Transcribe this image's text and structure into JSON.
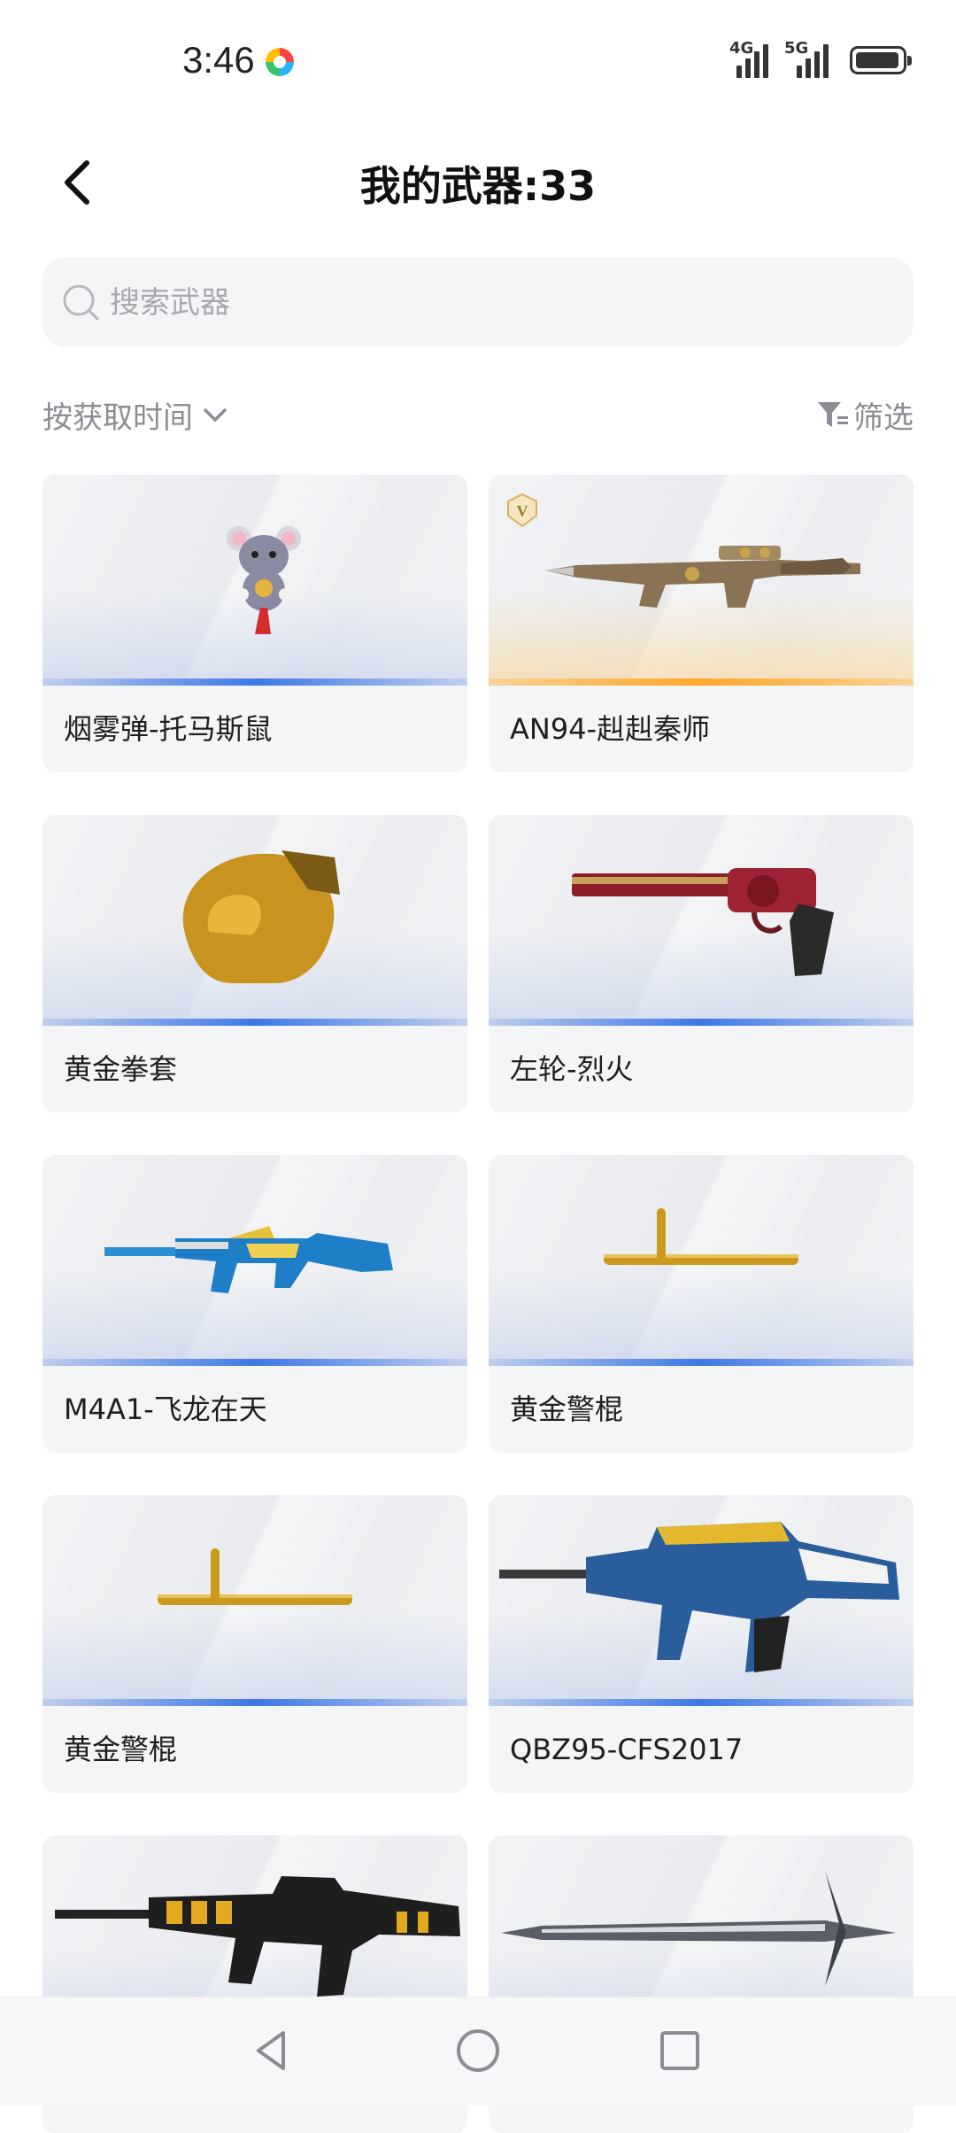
{
  "status_bar": {
    "time": "3:46",
    "network_1": "4G",
    "network_2": "5G"
  },
  "header": {
    "title": "我的武器:33"
  },
  "search": {
    "placeholder": "搜索武器",
    "value": ""
  },
  "toolbar": {
    "sort_label": "按获取时间",
    "filter_label": "筛选"
  },
  "weapons": [
    {
      "name": "烟雾弹-托马斯鼠",
      "rarity": "blue",
      "icon": "mouse-grenade-icon"
    },
    {
      "name": "AN94-赳赳秦师",
      "rarity": "gold",
      "icon": "an94-rifle-icon",
      "badge": "V"
    },
    {
      "name": "黄金拳套",
      "rarity": "blue",
      "icon": "boxing-glove-icon"
    },
    {
      "name": "左轮-烈火",
      "rarity": "blue",
      "icon": "revolver-icon"
    },
    {
      "name": "M4A1-飞龙在天",
      "rarity": "blue",
      "icon": "m4a1-rifle-icon"
    },
    {
      "name": "黄金警棍",
      "rarity": "blue",
      "icon": "baton-icon"
    },
    {
      "name": "黄金警棍",
      "rarity": "blue",
      "icon": "baton-icon"
    },
    {
      "name": "QBZ95-CFS2017",
      "rarity": "blue",
      "icon": "qbz95-rifle-icon"
    },
    {
      "name": "",
      "rarity": "blue",
      "icon": "gold-m4-rifle-icon"
    },
    {
      "name": "",
      "rarity": "blue",
      "icon": "silver-blade-icon"
    }
  ],
  "colors": {
    "accent_blue": "#3c78e6",
    "accent_gold": "#ffa726",
    "card_bg": "#f4f5f7",
    "muted_text": "#8a8d93"
  }
}
